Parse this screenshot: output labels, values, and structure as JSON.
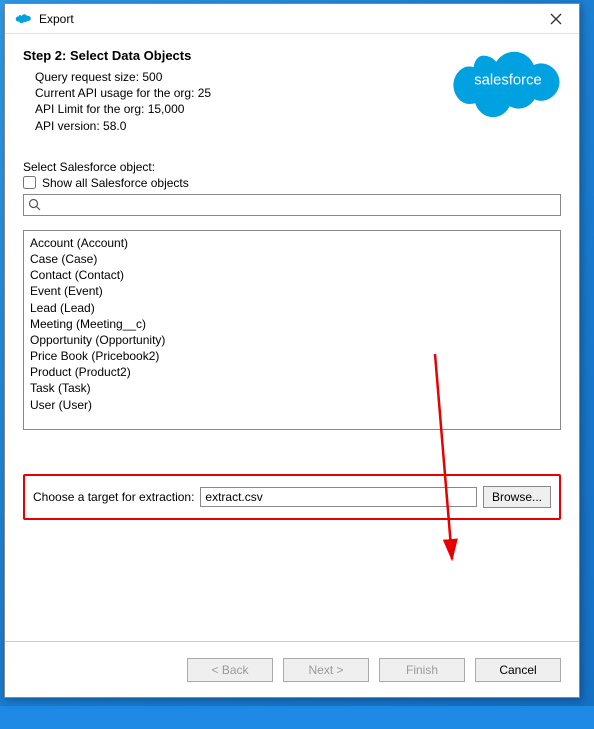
{
  "window": {
    "title": "Export"
  },
  "step": {
    "heading": "Step 2: Select Data Objects",
    "query_size": "Query request size: 500",
    "api_usage": "Current API usage for the org: 25",
    "api_limit": "API Limit for the org: 15,000",
    "api_version": "API version: 58.0"
  },
  "logo_text": "salesforce",
  "select_label": "Select Salesforce object:",
  "show_all_label": "Show all Salesforce objects",
  "search": {
    "placeholder": ""
  },
  "objects": [
    "Account (Account)",
    "Case (Case)",
    "Contact (Contact)",
    "Event (Event)",
    "Lead (Lead)",
    "Meeting (Meeting__c)",
    "Opportunity (Opportunity)",
    "Price Book (Pricebook2)",
    "Product (Product2)",
    "Task (Task)",
    "User (User)"
  ],
  "target": {
    "label": "Choose a target for extraction:",
    "value": "extract.csv",
    "browse": "Browse..."
  },
  "buttons": {
    "back": "< Back",
    "next": "Next >",
    "finish": "Finish",
    "cancel": "Cancel"
  },
  "annotation": {
    "color": "#e60000"
  }
}
